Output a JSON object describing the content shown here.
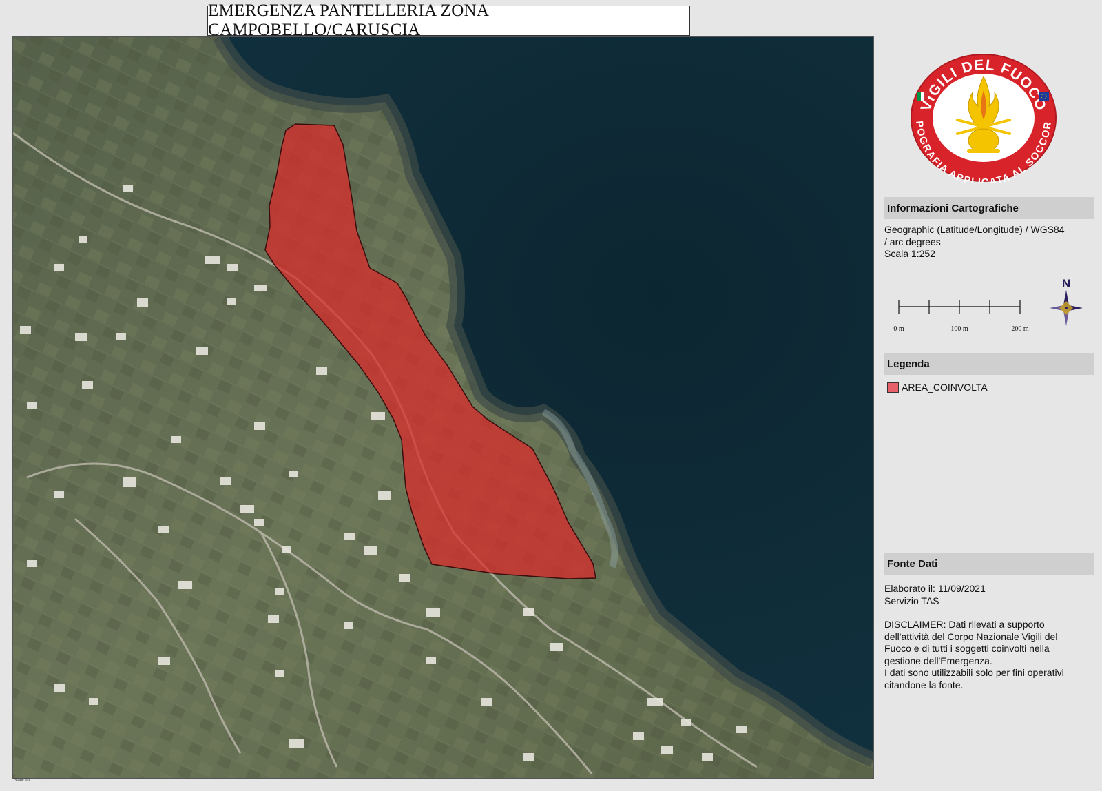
{
  "title": "EMERGENZA PANTELLERIA ZONA CAMPOBELLO/CARUSCIA",
  "logo": {
    "top_text": "VIGILI DEL FUOCO",
    "bottom_text": "TOPOGRAFIA APPLICATA AL SOCCORSO"
  },
  "cartographic": {
    "header": "Informazioni Cartografiche",
    "projection_line1": "Geographic (Latitude/Longitude) / WGS84",
    "projection_line2": "/ arc degrees",
    "scale_text": "Scala 1:252"
  },
  "scale_bar": {
    "labels": [
      "0 m",
      "100 m",
      "200 m"
    ],
    "north_label": "N"
  },
  "legend": {
    "header": "Legenda",
    "items": [
      {
        "label": "AREA_COINVOLTA",
        "color": "#e8606a"
      }
    ]
  },
  "source": {
    "header": "Fonte Dati",
    "elaborated": "Elaborato il: 11/09/2021",
    "service": "Servizio TAS",
    "disclaimer_lines": [
      "DISCLAIMER: Dati rilevati a supporto",
      "dell'attività del Corpo Nazionale Vigili del",
      "Fuoco e di tutti i soggetti coinvolti nella",
      "gestione dell'Emergenza.",
      "I dati sono utilizzabili solo per fini operativi",
      "citandone la fonte."
    ]
  },
  "footer_note": "Nome file",
  "colors": {
    "affected_area": "#dd2a2a",
    "sea": "#0f2a36",
    "land": "#5e6a4d",
    "logo_red": "#d9232a",
    "logo_yellow": "#f5c400"
  }
}
